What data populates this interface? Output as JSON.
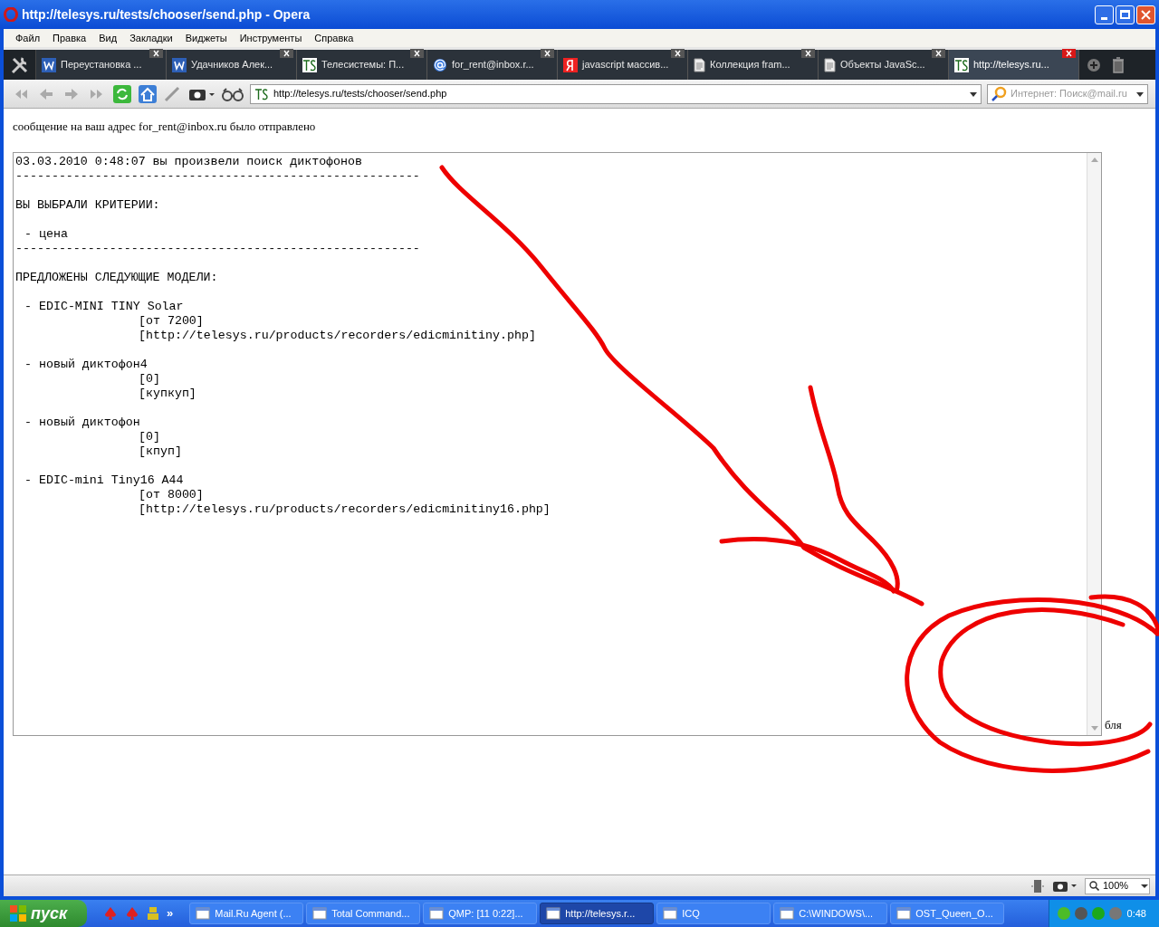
{
  "window": {
    "title": "http://telesys.ru/tests/chooser/send.php - Opera"
  },
  "menu": [
    "Файл",
    "Правка",
    "Вид",
    "Закладки",
    "Виджеты",
    "Инструменты",
    "Справка"
  ],
  "tabs": [
    {
      "label": "Переустановка ...",
      "kind": "word",
      "selected": false
    },
    {
      "label": "Удачников Алек...",
      "kind": "word",
      "selected": false
    },
    {
      "label": "Телесистемы: П...",
      "kind": "ts",
      "selected": false
    },
    {
      "label": "for_rent@inbox.r...",
      "kind": "mail",
      "selected": false
    },
    {
      "label": "javascript массив...",
      "kind": "yandex",
      "selected": false
    },
    {
      "label": "Коллекция fram...",
      "kind": "doc",
      "selected": false
    },
    {
      "label": "Объекты JavaSc...",
      "kind": "doc",
      "selected": false
    },
    {
      "label": "http://telesys.ru...",
      "kind": "ts",
      "selected": true
    }
  ],
  "address": {
    "url": "http://telesys.ru/tests/chooser/send.php",
    "search_placeholder": "Интернет: Поиск@mail.ru"
  },
  "page": {
    "message": "сообщение на ваш адрес for_rent@inbox.ru было отправлено",
    "report": {
      "blocks": [
        [
          "03.03.2010 0:48:07 вы произвели поиск диктофонов",
          "--------------------------------------------------------"
        ],
        [
          "ВЫ ВЫБРАЛИ КРИТЕРИИ:"
        ],
        [
          "- цена",
          "--------------------------------------------------------"
        ],
        [
          "ПРЕДЛОЖЕНЫ СЛЕДУЮЩИЕ МОДЕЛИ:"
        ]
      ],
      "models": [
        {
          "name": "- EDIC-MINI TINY Solar",
          "price": "[от 7200]",
          "link": "[http://telesys.ru/products/recorders/edicminitiny.php]"
        },
        {
          "name": "- новый диктофон4",
          "price": "[0]",
          "link": "[купкуп]"
        },
        {
          "name": "- новый диктофон",
          "price": "[0]",
          "link": "[кпуп]"
        },
        {
          "name": "- EDIC-mini Tiny16 A44",
          "price": "[от 8000]",
          "link": "[http://telesys.ru/products/recorders/edicminitiny16.php]"
        }
      ]
    },
    "side_text": "бля"
  },
  "status_bar": {
    "zoom": "100%"
  },
  "taskbar": {
    "start": "пуск",
    "more": "»",
    "items": [
      {
        "label": "Mail.Ru Agent (...",
        "selected": false
      },
      {
        "label": "Total Command...",
        "selected": false
      },
      {
        "label": "QMP: [11 0:22]...",
        "selected": false
      },
      {
        "label": "http://telesys.r...",
        "selected": true
      },
      {
        "label": "ICQ",
        "selected": false
      },
      {
        "label": "C:\\WINDOWS\\...",
        "selected": false
      },
      {
        "label": "OST_Queen_O...",
        "selected": false
      }
    ],
    "clock": "0:48"
  }
}
